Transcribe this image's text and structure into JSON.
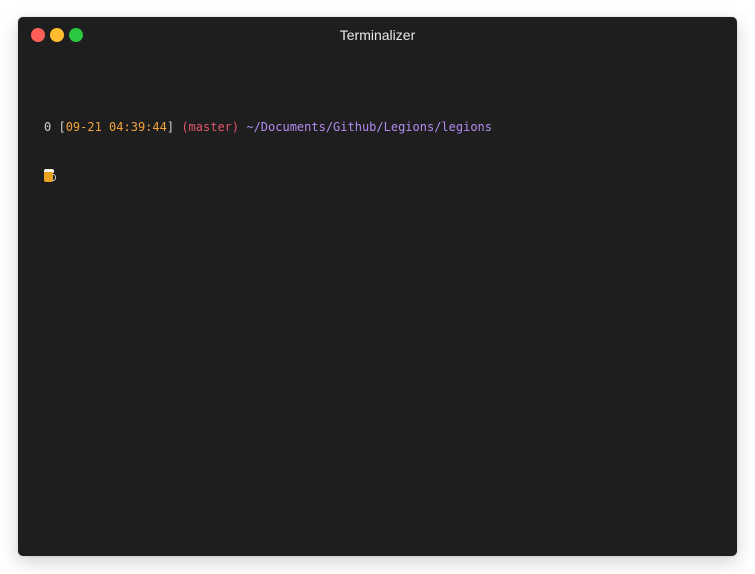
{
  "window": {
    "title": "Terminalizer"
  },
  "terminal": {
    "prompt": {
      "exit_code": "0",
      "bracket_open": "[",
      "timestamp": "09-21 04:39:44",
      "bracket_close": "]",
      "branch": "(master)",
      "path": "~/Documents/Github/Legions/legions"
    },
    "cursor_icon": "beer-mug-icon"
  },
  "colors": {
    "background": "#1e1e1e",
    "timestamp": "#f0a33c",
    "branch": "#e0556a",
    "path": "#b08cf0",
    "close": "#ff5f57",
    "minimize": "#febc2e",
    "maximize": "#28c840"
  }
}
